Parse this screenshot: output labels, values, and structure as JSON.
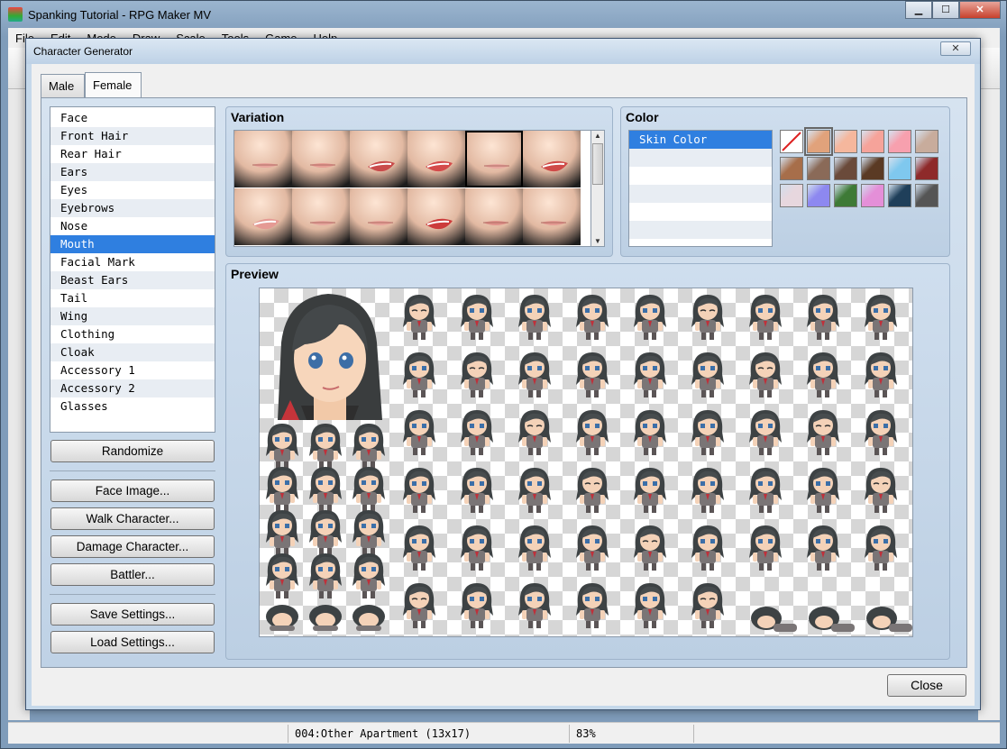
{
  "app": {
    "title": "Spanking Tutorial - RPG Maker MV",
    "menu": [
      "File",
      "Edit",
      "Mode",
      "Draw",
      "Scale",
      "Tools",
      "Game",
      "Help"
    ],
    "status_map": "004:Other Apartment (13x17)",
    "status_zoom": "83%"
  },
  "dialog": {
    "title": "Character Generator",
    "close_x": "✕",
    "tabs": {
      "male": "Male",
      "female": "Female",
      "active": "Female"
    },
    "parts": [
      "Face",
      "Front Hair",
      "Rear Hair",
      "Ears",
      "Eyes",
      "Eyebrows",
      "Nose",
      "Mouth",
      "Facial Mark",
      "Beast Ears",
      "Tail",
      "Wing",
      "Clothing",
      "Cloak",
      "Accessory 1",
      "Accessory 2",
      "Glasses"
    ],
    "selected_part": "Mouth",
    "buttons": {
      "randomize": "Randomize",
      "face_image": "Face Image...",
      "walk_character": "Walk Character...",
      "damage_character": "Damage Character...",
      "battler": "Battler...",
      "save_settings": "Save Settings...",
      "load_settings": "Load Settings..."
    },
    "variation": {
      "title": "Variation",
      "mouths": [
        {
          "lip": "#e8a59d",
          "open": false
        },
        {
          "lip": "#e79e95",
          "open": false
        },
        {
          "lip": "#c94b4b",
          "open": true
        },
        {
          "lip": "#d44b4b",
          "open": true
        },
        {
          "lip": "#e8a8a0",
          "open": false
        },
        {
          "lip": "#cf4a48",
          "open": true
        },
        {
          "lip": "#e59a94",
          "open": true
        },
        {
          "lip": "#e6a69e",
          "open": false
        },
        {
          "lip": "#e7a49b",
          "open": false
        },
        {
          "lip": "#cc3b3b",
          "open": true
        },
        {
          "lip": "#e0928b",
          "open": false
        },
        {
          "lip": "#e49b93",
          "open": false
        }
      ],
      "selected_index": 4
    },
    "color": {
      "title": "Color",
      "items": [
        "Skin Color"
      ],
      "selected_item": "Skin Color",
      "swatches": [
        "none",
        "#e1a27b",
        "#f5b79d",
        "#f6a39a",
        "#f7a0ae",
        "#c8ac9c",
        "#a76e4a",
        "#8a6a58",
        "#6a4a3a",
        "#5a3a24",
        "#7fc8ee",
        "#8e2a2a",
        "#e7d7de",
        "#8d88f0",
        "#3e7a36",
        "#e48fd8",
        "#1f3f5a",
        "#555555"
      ],
      "selected_swatch": 1
    },
    "preview": {
      "title": "Preview"
    },
    "close": "Close"
  }
}
